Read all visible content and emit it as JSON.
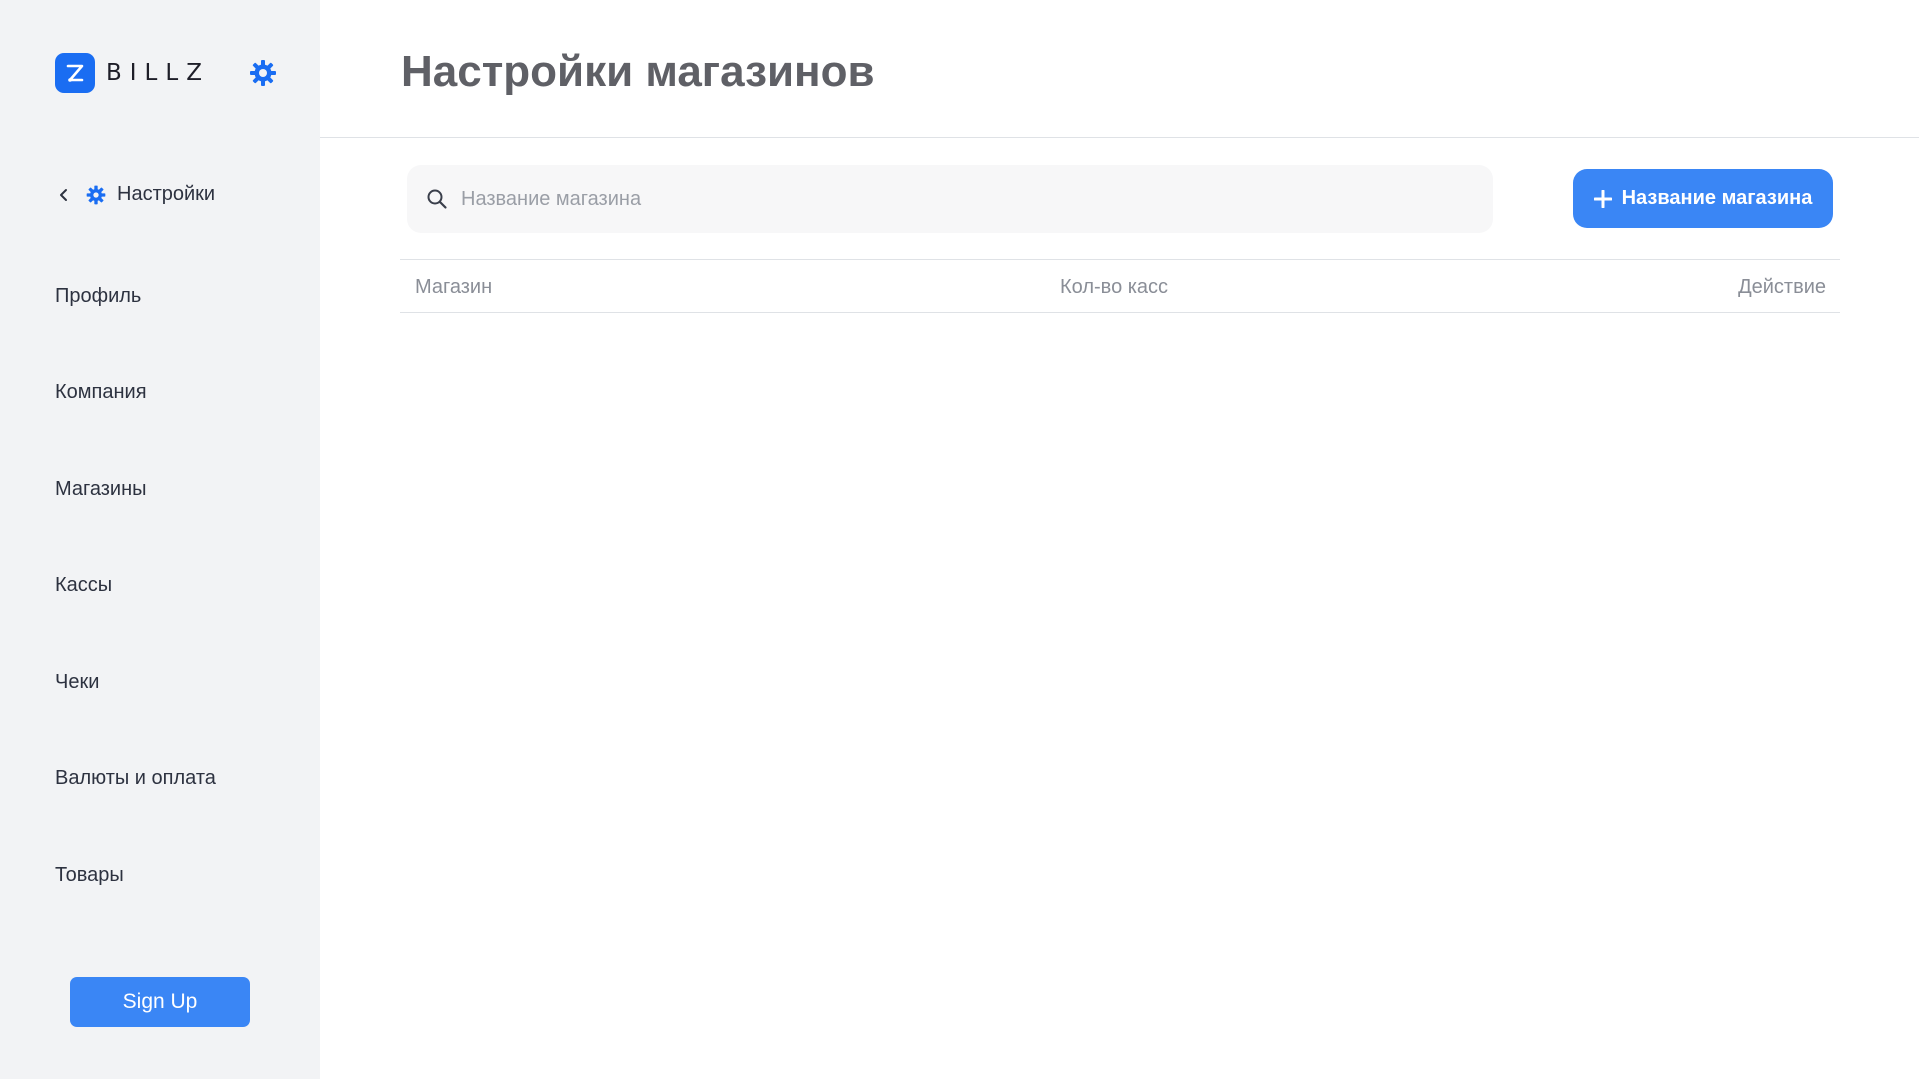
{
  "brand": {
    "name": "BILLZ",
    "accent": "#1a6df2",
    "logo_icon": "billz-logo-icon",
    "settings_icon": "gear-icon"
  },
  "sidebar": {
    "back": {
      "label": "Настройки",
      "chevron_icon": "chevron-left-icon",
      "icon": "gear-icon"
    },
    "items": [
      {
        "label": "Профиль"
      },
      {
        "label": "Компания"
      },
      {
        "label": "Магазины"
      },
      {
        "label": "Кассы"
      },
      {
        "label": "Чеки"
      },
      {
        "label": "Валюты и оплата"
      },
      {
        "label": "Товары"
      }
    ],
    "signup_label": "Sign Up"
  },
  "main": {
    "title": "Настройки магазинов",
    "search": {
      "placeholder": "Название магазина",
      "value": "",
      "icon": "search-icon"
    },
    "add_button": {
      "label": "Название магазина",
      "icon": "plus-icon"
    },
    "table": {
      "columns": [
        "Магазин",
        "Кол-во касс",
        "Действие"
      ],
      "rows": []
    }
  },
  "colors": {
    "primary": "#3a86f5",
    "sidebar_bg": "#f2f3f5",
    "title": "#5f6066",
    "muted": "#8a8e97"
  }
}
